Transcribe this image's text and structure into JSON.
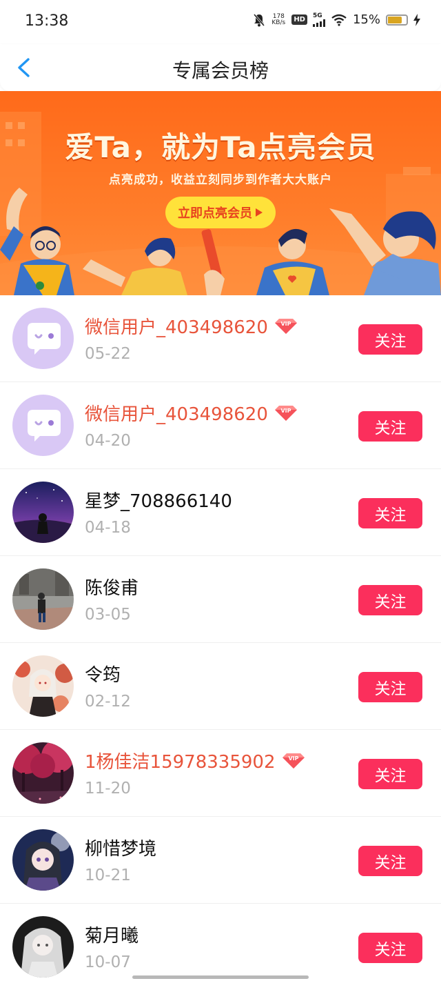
{
  "status_bar": {
    "time": "13:38",
    "net_speed_value": "178",
    "net_speed_unit": "KB/s",
    "hd": "HD",
    "network": "5G",
    "battery": "15%",
    "icons": [
      "mute-bell-icon",
      "signal-icon",
      "wifi-icon",
      "battery-icon",
      "charging-icon"
    ]
  },
  "nav": {
    "title": "专属会员榜",
    "back_icon": "chevron-left-icon"
  },
  "banner": {
    "headline": "爱Ta，就为Ta点亮会员",
    "subtitle": "点亮成功，收益立刻同步到作者大大账户",
    "cta": "立即点亮会员"
  },
  "colors": {
    "accent_blue": "#2196f3",
    "vip_name": "#e8543b",
    "follow_button": "#fb2f5c",
    "banner_orange": "#ff6a1a",
    "cta_yellow": "#ffe23a"
  },
  "members": [
    {
      "name": "微信用户_403498620",
      "date": "05-22",
      "vip": true,
      "follow_label": "关注",
      "avatar": "wechat-default-avatar"
    },
    {
      "name": "微信用户_403498620",
      "date": "04-20",
      "vip": true,
      "follow_label": "关注",
      "avatar": "wechat-default-avatar"
    },
    {
      "name": "星梦_708866140",
      "date": "04-18",
      "vip": false,
      "follow_label": "关注",
      "avatar": "night-sky-avatar"
    },
    {
      "name": "陈俊甫",
      "date": "03-05",
      "vip": false,
      "follow_label": "关注",
      "avatar": "street-photo-avatar"
    },
    {
      "name": "令筠",
      "date": "02-12",
      "vip": false,
      "follow_label": "关注",
      "avatar": "anime-autumn-avatar"
    },
    {
      "name": "1杨佳洁15978335902",
      "date": "11-20",
      "vip": true,
      "follow_label": "关注",
      "avatar": "pink-trees-avatar"
    },
    {
      "name": "柳惜梦境",
      "date": "10-21",
      "vip": false,
      "follow_label": "关注",
      "avatar": "anime-girl-avatar"
    },
    {
      "name": "菊月曦",
      "date": "10-07",
      "vip": false,
      "follow_label": "关注",
      "avatar": "silver-hair-avatar"
    }
  ],
  "vip_badge": "VIP"
}
